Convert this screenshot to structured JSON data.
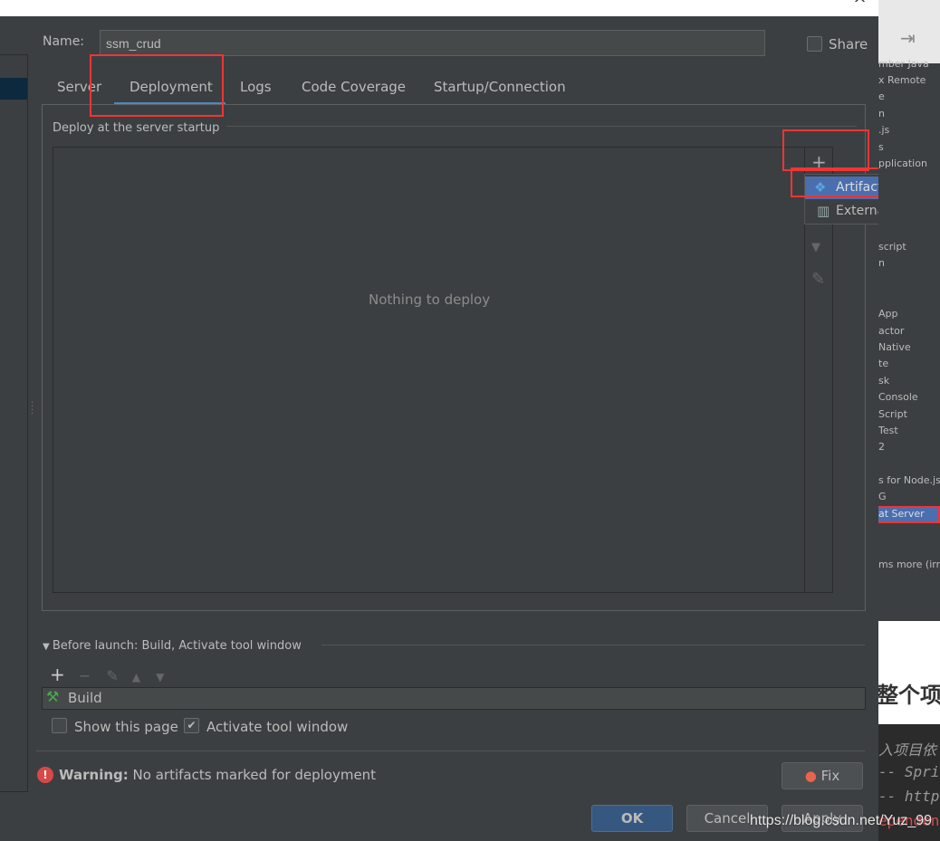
{
  "dialog": {
    "name_label": "Name:",
    "name_value": "ssm_crud",
    "share_label": "Share"
  },
  "tabs": [
    {
      "label": "Server"
    },
    {
      "label": "Deployment",
      "active": true
    },
    {
      "label": "Logs"
    },
    {
      "label": "Code Coverage"
    },
    {
      "label": "Startup/Connection"
    }
  ],
  "deploy": {
    "group_label": "Deploy at the server startup",
    "empty_text": "Nothing to deploy",
    "icons": [
      "plus-icon",
      "arrow-down-icon",
      "edit-icon"
    ]
  },
  "popup": {
    "items": [
      {
        "label": "Artifact...",
        "icon": "artifact-icon"
      },
      {
        "label": "External Source...",
        "icon": "external-source-icon"
      }
    ]
  },
  "before_launch": {
    "label": "Before launch: Build, Activate tool window",
    "tasks": [
      {
        "label": "Build",
        "icon": "hammer-icon"
      }
    ],
    "show_page_label": "Show this page",
    "show_page_checked": false,
    "activate_label": "Activate tool window",
    "activate_checked": true
  },
  "warning": {
    "bold": "Warning:",
    "text": "No artifacts marked for deployment",
    "fix_label": "Fix"
  },
  "buttons": {
    "ok": "OK",
    "cancel": "Cancel",
    "apply": "Apply"
  },
  "background_window": {
    "list_items": [
      "mber Java",
      "x Remote",
      "e",
      "n",
      ".js",
      "s",
      "pplication",
      "script",
      "n",
      "App",
      "actor",
      "Native",
      "te",
      "sk",
      "Console",
      "Script",
      "Test",
      "2",
      "s for Node.js",
      "G",
      "at Server",
      "ms more (irre"
    ],
    "selected": "at Server",
    "heading": "整个项",
    "code_lines": [
      "入项目依",
      "-- Spri",
      "-- http",
      "ependen"
    ]
  },
  "watermark": "https://blog.csdn.net/Yuz_99",
  "colors": {
    "background": "#3c3f41",
    "accent": "#4a88c7",
    "selection": "#4b6eaf",
    "highlight_box": "#f03535",
    "warning": "#d94848"
  }
}
